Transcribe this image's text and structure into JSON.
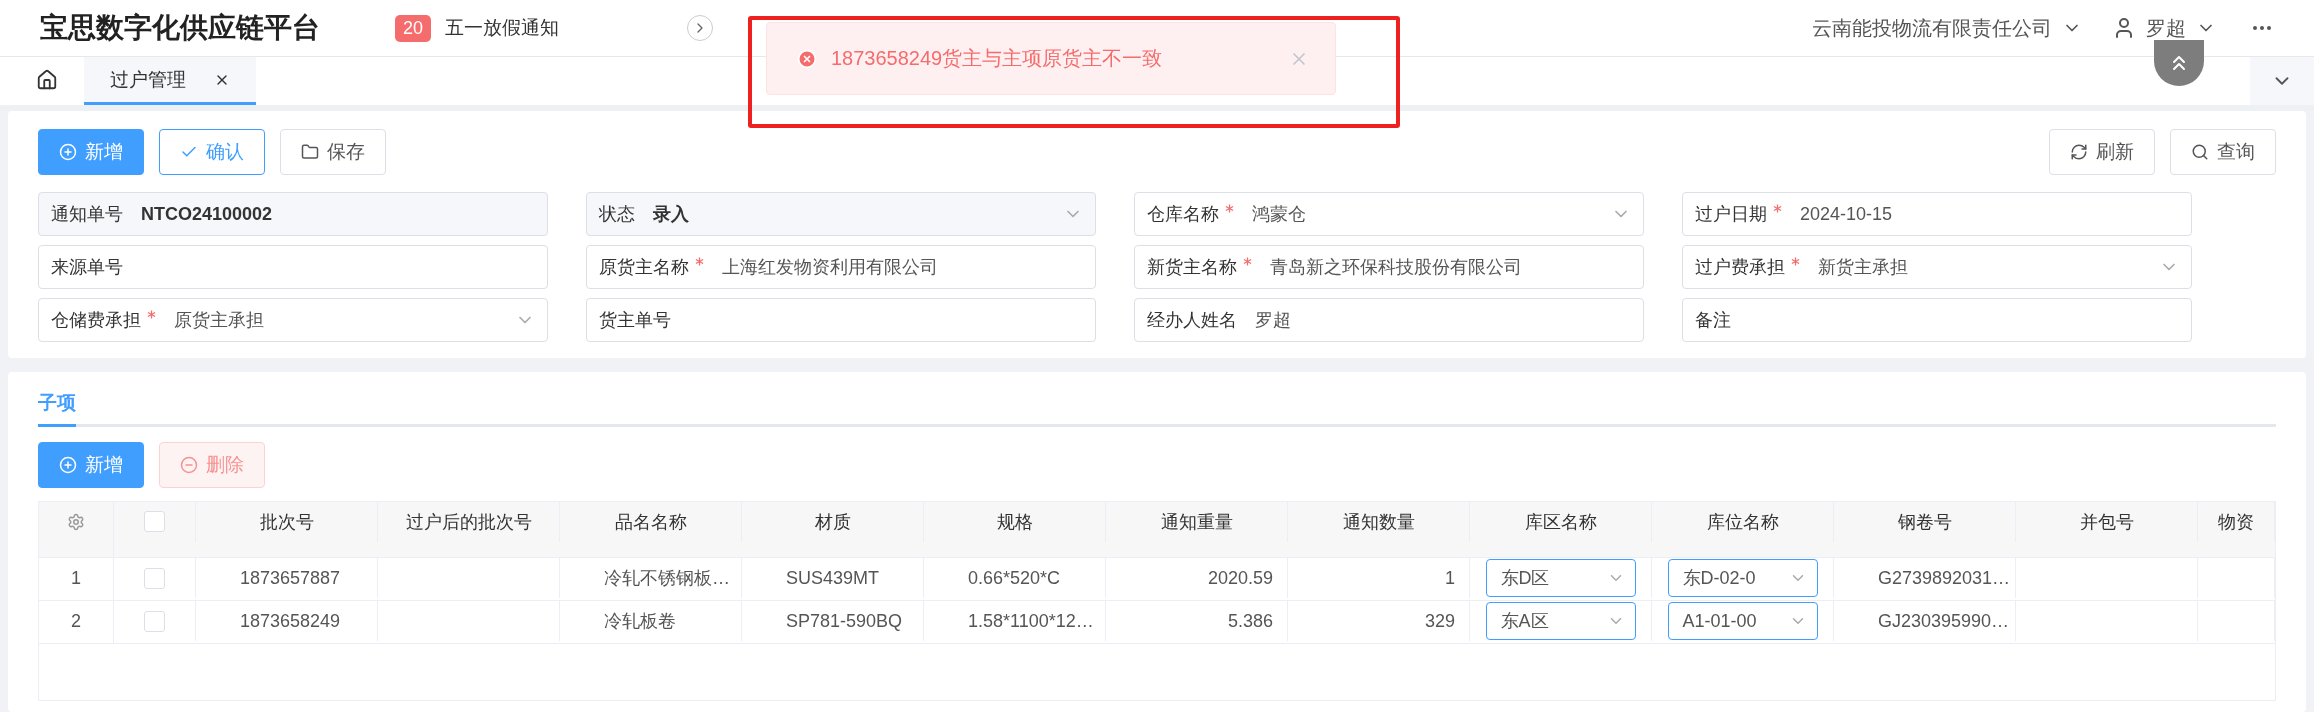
{
  "header": {
    "title": "宝思数字化供应链平台",
    "notice_count": "20",
    "notice_text": "五一放假通知",
    "company": "云南能投物流有限责任公司",
    "user": "罗超"
  },
  "tabs": [
    {
      "kind": "home",
      "selected": false
    },
    {
      "kind": "page",
      "label": "过户管理",
      "selected": true
    }
  ],
  "toast": {
    "message": "1873658249货主与主项原货主不一致",
    "highlighted": true
  },
  "toolbar": {
    "left": [
      {
        "kind": "primary",
        "label": "新增"
      },
      {
        "kind": "outline",
        "label": "确认"
      },
      {
        "kind": "plain",
        "label": "保存"
      }
    ],
    "right": [
      {
        "kind": "plain",
        "label": "刷新"
      },
      {
        "kind": "plain",
        "label": "查询"
      }
    ]
  },
  "form": [
    {
      "label": "通知单号",
      "required": false,
      "kind": "text",
      "readonly": true,
      "value": "NTCO24100002"
    },
    {
      "label": "状态",
      "required": false,
      "kind": "select",
      "readonly": true,
      "value": "录入"
    },
    {
      "label": "仓库名称",
      "required": true,
      "kind": "select",
      "readonly": false,
      "value": "鸿蒙仓"
    },
    {
      "label": "过户日期",
      "required": true,
      "kind": "text",
      "readonly": false,
      "value": "2024-10-15"
    },
    {
      "label": "来源单号",
      "required": false,
      "kind": "text",
      "readonly": false
    },
    {
      "label": "原货主名称",
      "required": true,
      "kind": "text",
      "readonly": false,
      "value": "上海红发物资利用有限公司"
    },
    {
      "label": "新货主名称",
      "required": true,
      "kind": "text",
      "readonly": false,
      "value": "青岛新之环保科技股份有限公司"
    },
    {
      "label": "过户费承担",
      "required": true,
      "kind": "select",
      "readonly": false,
      "value": "新货主承担"
    },
    {
      "label": "仓储费承担",
      "required": true,
      "kind": "select",
      "readonly": false,
      "value": "原货主承担"
    },
    {
      "label": "货主单号",
      "required": false,
      "kind": "text",
      "readonly": false
    },
    {
      "label": "经办人姓名",
      "required": false,
      "kind": "text",
      "readonly": false,
      "value": "罗超"
    },
    {
      "label": "备注",
      "required": false,
      "kind": "text",
      "readonly": false
    }
  ],
  "sub_tabs": [
    {
      "label": "子项",
      "selected": true
    }
  ],
  "sub_toolbar": [
    {
      "kind": "primary",
      "label": "新增",
      "disabled": false
    },
    {
      "kind": "danger",
      "label": "删除",
      "disabled": true
    }
  ],
  "table": {
    "all_checked": false,
    "columns": [
      "批次号",
      "过户后的批次号",
      "品名名称",
      "材质",
      "规格",
      "通知重量",
      "通知数量",
      "库区名称",
      "库位名称",
      "钢卷号",
      "并包号",
      "物资"
    ],
    "rows": [
      {
        "index": "1",
        "checked": false,
        "batch": "1873657887",
        "product": "冷轧不锈钢板…",
        "material": "SUS439MT",
        "spec": "0.66*520*C",
        "weight": "2020.59",
        "quantity": "1",
        "zone": "东D区",
        "location": "东D-02-0",
        "coil": "G2739892031…"
      },
      {
        "index": "2",
        "checked": false,
        "batch": "1873658249",
        "product": "冷轧板卷",
        "material": "SP781-590BQ",
        "spec": "1.58*1100*12…",
        "weight": "5.386",
        "quantity": "329",
        "zone": "东A区",
        "location": "A1-01-00",
        "coil": "GJ230395990…"
      }
    ]
  }
}
